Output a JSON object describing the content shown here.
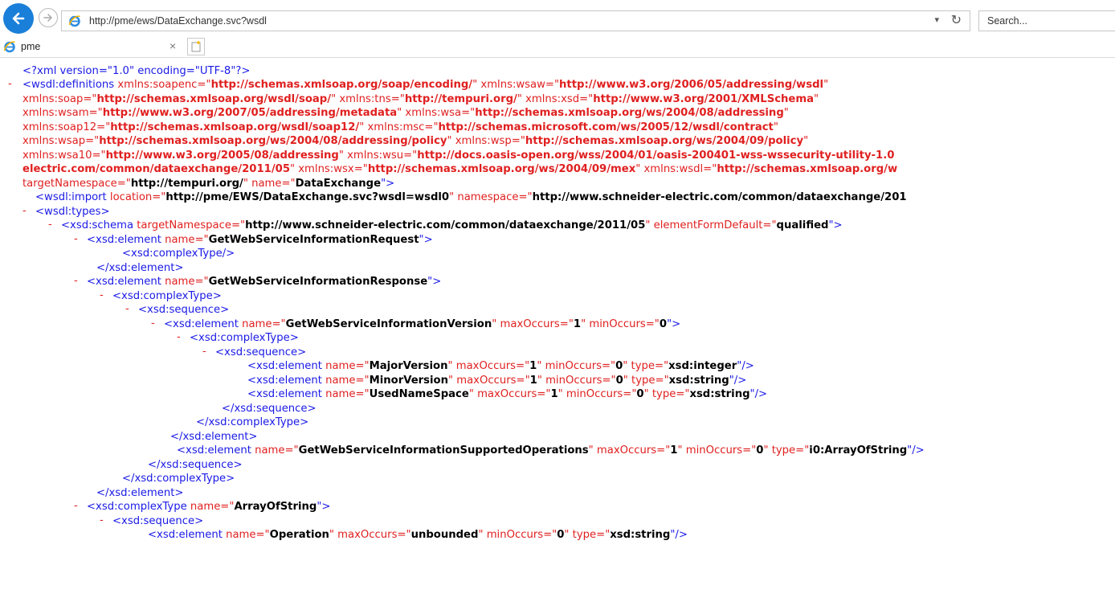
{
  "browser": {
    "address_url": "http://pme/ews/DataExchange.svc?wsdl",
    "search_placeholder": "Search...",
    "tab_title": "pme",
    "tab_close": "×"
  },
  "xml": {
    "decl": {
      "prefix": "<?xml version=\"1.0\" encoding=\"UTF-8\"?>"
    },
    "definitions": {
      "toggle": "-",
      "l1_tag": "<wsdl:definitions",
      "l1_a1": " xmlns:soapenc=\"",
      "l1_v1": "http://schemas.xmlsoap.org/soap/encoding/",
      "l1_a2": "\" xmlns:wsaw=\"",
      "l1_v2": "http://www.w3.org/2006/05/addressing/wsdl",
      "l1_end": "\"",
      "l2_a1": "xmlns:soap=\"",
      "l2_v1": "http://schemas.xmlsoap.org/wsdl/soap/",
      "l2_a2": "\" xmlns:tns=\"",
      "l2_v2": "http://tempuri.org/",
      "l2_a3": "\" xmlns:xsd=\"",
      "l2_v3": "http://www.w3.org/2001/XMLSchema",
      "l2_end": "\"",
      "l3_a1": "xmlns:wsam=\"",
      "l3_v1": "http://www.w3.org/2007/05/addressing/metadata",
      "l3_a2": "\" xmlns:wsa=\"",
      "l3_v2": "http://schemas.xmlsoap.org/ws/2004/08/addressing",
      "l3_end": "\"",
      "l4_a1": "xmlns:soap12=\"",
      "l4_v1": "http://schemas.xmlsoap.org/wsdl/soap12/",
      "l4_a2": "\" xmlns:msc=\"",
      "l4_v2": "http://schemas.microsoft.com/ws/2005/12/wsdl/contract",
      "l4_end": "\"",
      "l5_a1": "xmlns:wsap=\"",
      "l5_v1": "http://schemas.xmlsoap.org/ws/2004/08/addressing/policy",
      "l5_a2": "\" xmlns:wsp=\"",
      "l5_v2": "http://schemas.xmlsoap.org/ws/2004/09/policy",
      "l5_end": "\"",
      "l6_a1": "xmlns:wsa10=\"",
      "l6_v1": "http://www.w3.org/2005/08/addressing",
      "l6_a2": "\" xmlns:wsu=\"",
      "l6_v2": "http://docs.oasis-open.org/wss/2004/01/oasis-200401-wss-wssecurity-utility-1.0",
      "l7_v1": "electric.com/common/dataexchange/2011/05",
      "l7_a1": "\" xmlns:wsx=\"",
      "l7_v2": "http://schemas.xmlsoap.org/ws/2004/09/mex",
      "l7_a2": "\" xmlns:wsdl=\"",
      "l7_v3": "http://schemas.xmlsoap.org/w",
      "l8_a1": "targetNamespace=\"",
      "l8_v1": "http://tempuri.org/",
      "l8_a2": "\" name=\"",
      "l8_v2": "DataExchange",
      "l8_end": "\">"
    },
    "import": {
      "tag": "<wsdl:import",
      "a1": " location=\"",
      "v1": "http://pme/EWS/DataExchange.svc?wsdl=wsdl0",
      "a2": "\" namespace=\"",
      "v2": "http://www.schneider-electric.com/common/dataexchange/201"
    },
    "types": {
      "toggle": "-",
      "tag": "<wsdl:types>"
    },
    "schema": {
      "toggle": "-",
      "tag": "<xsd:schema",
      "a1": " targetNamespace=\"",
      "v1": "http://www.schneider-electric.com/common/dataexchange/2011/05",
      "a2": "\" elementFormDefault=\"",
      "v2": "qualified",
      "end": "\">"
    },
    "el_request": {
      "toggle": "-",
      "tag": "<xsd:element",
      "a1": " name=\"",
      "v1": "GetWebServiceInformationRequest",
      "end": "\">"
    },
    "ct_empty": {
      "tag": "<xsd:complexType/>"
    },
    "close_element_1": {
      "tag": "</xsd:element>"
    },
    "el_response": {
      "toggle": "-",
      "tag": "<xsd:element",
      "a1": " name=\"",
      "v1": "GetWebServiceInformationResponse",
      "end": "\">"
    },
    "ct_response": {
      "toggle": "-",
      "tag": "<xsd:complexType>"
    },
    "seq_response": {
      "toggle": "-",
      "tag": "<xsd:sequence>"
    },
    "el_version": {
      "toggle": "-",
      "tag": "<xsd:element",
      "a1": " name=\"",
      "v1": "GetWebServiceInformationVersion",
      "a2": "\" maxOccurs=\"",
      "v2": "1",
      "a3": "\" minOccurs=\"",
      "v3": "0",
      "end": "\">"
    },
    "ct_version": {
      "toggle": "-",
      "tag": "<xsd:complexType>"
    },
    "seq_version": {
      "toggle": "-",
      "tag": "<xsd:sequence>"
    },
    "el_major": {
      "tag": "<xsd:element",
      "a1": " name=\"",
      "v1": "MajorVersion",
      "a2": "\" maxOccurs=\"",
      "v2": "1",
      "a3": "\" minOccurs=\"",
      "v3": "0",
      "a4": "\" type=\"",
      "v4": "xsd:integer",
      "end": "\"/>"
    },
    "el_minor": {
      "tag": "<xsd:element",
      "a1": " name=\"",
      "v1": "MinorVersion",
      "a2": "\" maxOccurs=\"",
      "v2": "1",
      "a3": "\" minOccurs=\"",
      "v3": "0",
      "a4": "\" type=\"",
      "v4": "xsd:string",
      "end": "\"/>"
    },
    "el_usedns": {
      "tag": "<xsd:element",
      "a1": " name=\"",
      "v1": "UsedNameSpace",
      "a2": "\" maxOccurs=\"",
      "v2": "1",
      "a3": "\" minOccurs=\"",
      "v3": "0",
      "a4": "\" type=\"",
      "v4": "xsd:string",
      "end": "\"/>"
    },
    "close_seq_1": {
      "tag": "</xsd:sequence>"
    },
    "close_ct_1": {
      "tag": "</xsd:complexType>"
    },
    "close_element_2": {
      "tag": "</xsd:element>"
    },
    "el_supported": {
      "tag": "<xsd:element",
      "a1": " name=\"",
      "v1": "GetWebServiceInformationSupportedOperations",
      "a2": "\" maxOccurs=\"",
      "v2": "1",
      "a3": "\" minOccurs=\"",
      "v3": "0",
      "a4": "\" type=\"",
      "v4": "i0:ArrayOfString",
      "end": "\"/>"
    },
    "close_seq_2": {
      "tag": "</xsd:sequence>"
    },
    "close_ct_2": {
      "tag": "</xsd:complexType>"
    },
    "close_element_3": {
      "tag": "</xsd:element>"
    },
    "ct_array": {
      "toggle": "-",
      "tag": "<xsd:complexType",
      "a1": " name=\"",
      "v1": "ArrayOfString",
      "end": "\">"
    },
    "seq_array": {
      "toggle": "-",
      "tag": "<xsd:sequence>"
    },
    "el_operation": {
      "tag": "<xsd:element",
      "a1": " name=\"",
      "v1": "Operation",
      "a2": "\" maxOccurs=\"",
      "v2": "unbounded",
      "a3": "\" minOccurs=\"",
      "v3": "0",
      "a4": "\" type=\"",
      "v4": "xsd:string",
      "end": "\"/>"
    }
  }
}
